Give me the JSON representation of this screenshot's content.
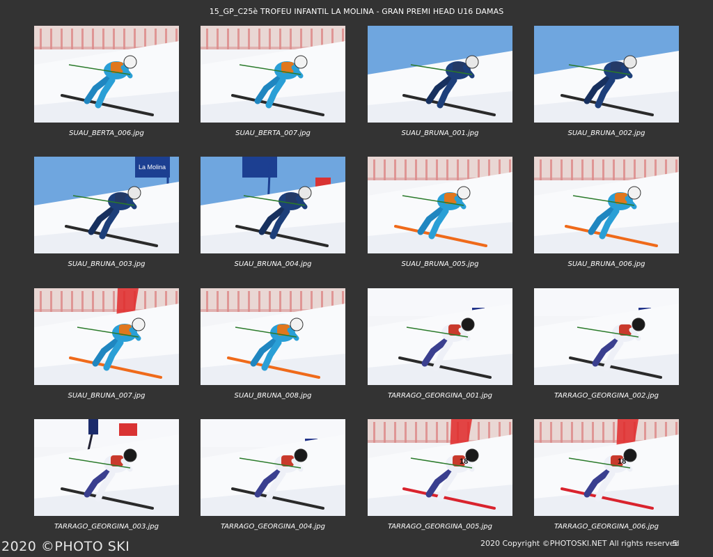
{
  "page_title": "15_GP_C25è TROFEU INFANTIL LA MOLINA - GRAN PREMI HEAD U16 DAMAS",
  "photos": [
    {
      "filename": "SUAU_BERTA_006.jpg",
      "scene": "fence",
      "suit": "cyan",
      "ski": "dark"
    },
    {
      "filename": "SUAU_BERTA_007.jpg",
      "scene": "fence",
      "suit": "cyan",
      "ski": "dark"
    },
    {
      "filename": "SUAU_BRUNA_001.jpg",
      "scene": "sky",
      "suit": "navy",
      "ski": "dark"
    },
    {
      "filename": "SUAU_BRUNA_002.jpg",
      "scene": "sky",
      "suit": "navy",
      "ski": "dark"
    },
    {
      "filename": "SUAU_BRUNA_003.jpg",
      "scene": "sky-banner",
      "suit": "navy",
      "ski": "dark",
      "banner_text": "La Molina"
    },
    {
      "filename": "SUAU_BRUNA_004.jpg",
      "scene": "sky-banner",
      "suit": "navy",
      "ski": "dark"
    },
    {
      "filename": "SUAU_BRUNA_005.jpg",
      "scene": "fence",
      "suit": "cyan",
      "ski": "orange"
    },
    {
      "filename": "SUAU_BRUNA_006.jpg",
      "scene": "fence",
      "suit": "cyan",
      "ski": "orange"
    },
    {
      "filename": "SUAU_BRUNA_007.jpg",
      "scene": "fence-red",
      "suit": "cyan",
      "ski": "orange"
    },
    {
      "filename": "SUAU_BRUNA_008.jpg",
      "scene": "fence",
      "suit": "cyan",
      "ski": "orange"
    },
    {
      "filename": "TARRAGO_GEORGINA_001.jpg",
      "scene": "white",
      "suit": "white",
      "ski": "dark"
    },
    {
      "filename": "TARRAGO_GEORGINA_002.jpg",
      "scene": "white",
      "suit": "white",
      "ski": "dark"
    },
    {
      "filename": "TARRAGO_GEORGINA_003.jpg",
      "scene": "white-gate",
      "suit": "white",
      "ski": "dark"
    },
    {
      "filename": "TARRAGO_GEORGINA_004.jpg",
      "scene": "white",
      "suit": "white",
      "ski": "dark"
    },
    {
      "filename": "TARRAGO_GEORGINA_005.jpg",
      "scene": "fence-red",
      "suit": "white",
      "ski": "red",
      "bib_number": "18"
    },
    {
      "filename": "TARRAGO_GEORGINA_006.jpg",
      "scene": "fence-red",
      "suit": "white",
      "ski": "red",
      "bib_number": "18"
    }
  ],
  "footer": {
    "watermark": "2020 ©PHOTO SKI",
    "copyright": "2020 Copyright ©PHOTOSKI.NET All rights reserved",
    "page_number": "5"
  }
}
